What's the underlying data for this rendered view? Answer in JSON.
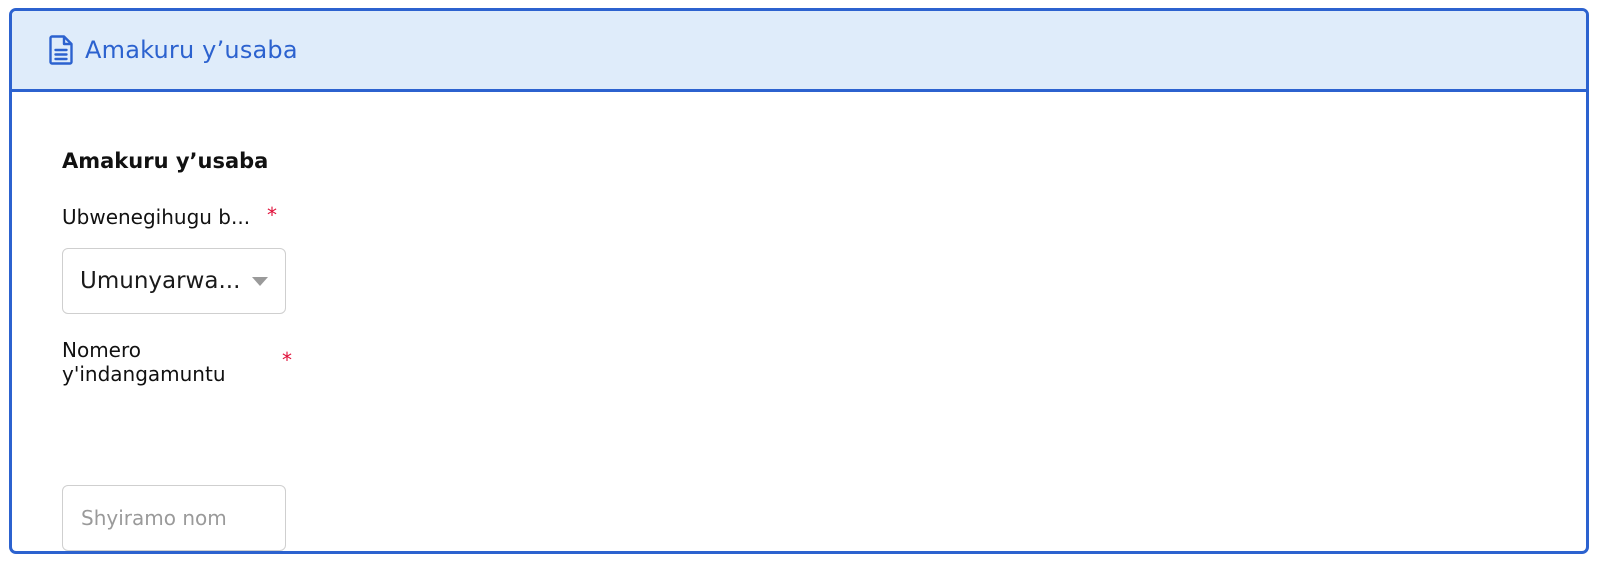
{
  "card": {
    "title": "Amakuru y’usaba",
    "icon": "document-icon",
    "accent_color": "#2c62cf",
    "header_background": "#dfecfa"
  },
  "form": {
    "section_title": "Amakuru y’usaba",
    "required_marker": "*",
    "required_color": "#e0103a",
    "nationality": {
      "label": "Ubwenegihugu b...",
      "selected_value": "Umunyarwa..."
    },
    "id_number": {
      "label_line1": "Nomero",
      "label_line2": "y'indangamuntu",
      "placeholder": "Shyiramo nom",
      "value": ""
    }
  }
}
